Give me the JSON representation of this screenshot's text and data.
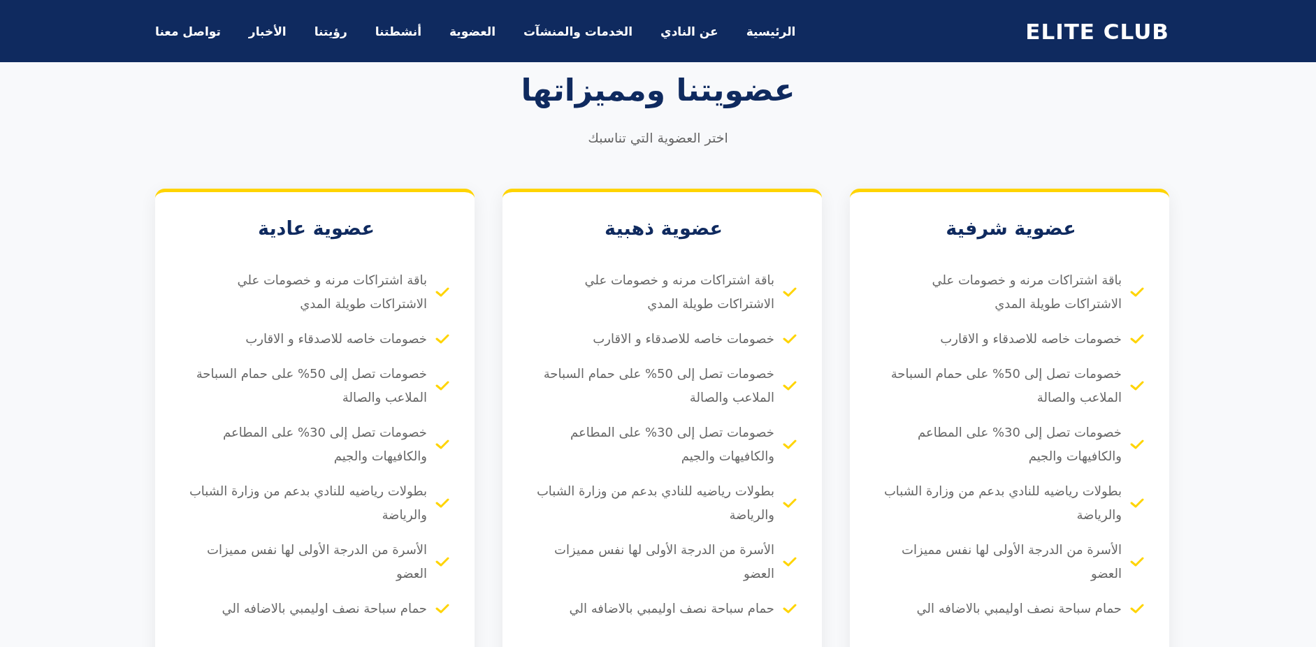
{
  "header": {
    "logo": "ELITE CLUB",
    "nav": [
      "الرئيسية",
      "عن النادي",
      "الخدمات والمنشآت",
      "العضوية",
      "أنشطتنا",
      "رؤيتنا",
      "الأخبار",
      "تواصل معنا"
    ]
  },
  "section": {
    "title": "عضويتنا ومميزاتها",
    "subtitle": "اختر العضوية التي تناسبك"
  },
  "cards": [
    {
      "title": "عضوية شرفية",
      "features": [
        "باقة اشتراكات مرنه و خصومات علي الاشتراكات طويلة المدي",
        "خصومات خاصه للاصدقاء و الاقارب",
        "خصومات تصل إلى 50% على حمام السباحة الملاعب والصالة",
        "خصومات تصل إلى 30% على المطاعم والكافيهات والجيم",
        "بطولات رياضيه للنادي بدعم من وزارة الشباب والرياضة",
        "الأسرة من الدرجة الأولى لها نفس مميزات العضو",
        "حمام سباحة نصف اوليمبي بالاضافه الي"
      ]
    },
    {
      "title": "عضوية ذهبية",
      "features": [
        "باقة اشتراكات مرنه و خصومات علي الاشتراكات طويلة المدي",
        "خصومات خاصه للاصدقاء و الاقارب",
        "خصومات تصل إلى 50% على حمام السباحة الملاعب والصالة",
        "خصومات تصل إلى 30% على المطاعم والكافيهات والجيم",
        "بطولات رياضيه للنادي بدعم من وزارة الشباب والرياضة",
        "الأسرة من الدرجة الأولى لها نفس مميزات العضو",
        "حمام سباحة نصف اوليمبي بالاضافه الي"
      ]
    },
    {
      "title": "عضوية عادية",
      "features": [
        "باقة اشتراكات مرنه و خصومات علي الاشتراكات طويلة المدي",
        "خصومات خاصه للاصدقاء و الاقارب",
        "خصومات تصل إلى 50% على حمام السباحة الملاعب والصالة",
        "خصومات تصل إلى 30% على المطاعم والكافيهات والجيم",
        "بطولات رياضيه للنادي بدعم من وزارة الشباب والرياضة",
        "الأسرة من الدرجة الأولى لها نفس مميزات العضو",
        "حمام سباحة نصف اوليمبي بالاضافه الي"
      ]
    }
  ]
}
